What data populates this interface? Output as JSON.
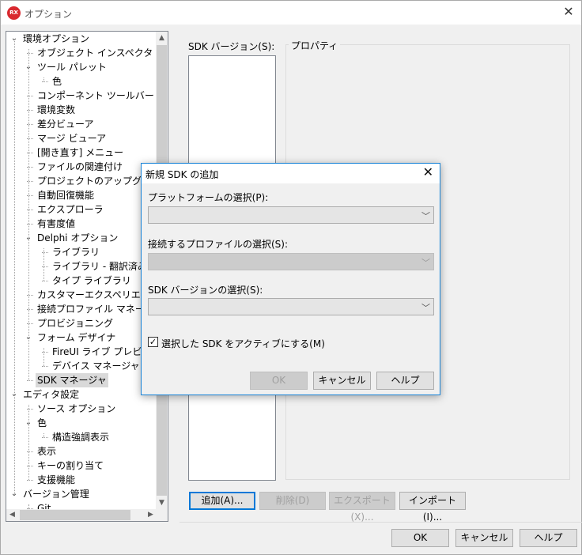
{
  "window": {
    "app_logo": "RX",
    "title": "オプション",
    "close_glyph": "✕"
  },
  "tree": {
    "items": [
      {
        "label": "環境オプション",
        "level": 0,
        "expanded": true
      },
      {
        "label": "オブジェクト インスペクタ",
        "level": 1
      },
      {
        "label": "ツール パレット",
        "level": 1,
        "expanded": true
      },
      {
        "label": "色",
        "level": 2
      },
      {
        "label": "コンポーネント ツールバー",
        "level": 1
      },
      {
        "label": "環境変数",
        "level": 1
      },
      {
        "label": "差分ビューア",
        "level": 1
      },
      {
        "label": "マージ ビューア",
        "level": 1
      },
      {
        "label": "[開き直す] メニュー",
        "level": 1
      },
      {
        "label": "ファイルの関連付け",
        "level": 1
      },
      {
        "label": "プロジェクトのアップグレード",
        "level": 1
      },
      {
        "label": "自動回復機能",
        "level": 1
      },
      {
        "label": "エクスプローラ",
        "level": 1
      },
      {
        "label": "有害度値",
        "level": 1
      },
      {
        "label": "Delphi オプション",
        "level": 1,
        "expanded": true
      },
      {
        "label": "ライブラリ",
        "level": 2
      },
      {
        "label": "ライブラリ - 翻訳済み",
        "level": 2
      },
      {
        "label": "タイプ ライブラリ",
        "level": 2
      },
      {
        "label": "カスタマーエクスペリエンス プ",
        "level": 1
      },
      {
        "label": "接続プロファイル マネージャ",
        "level": 1
      },
      {
        "label": "プロビジョニング",
        "level": 1
      },
      {
        "label": "フォーム デザイナ",
        "level": 1,
        "expanded": true
      },
      {
        "label": "FireUI ライブ プレビュー",
        "level": 2
      },
      {
        "label": "デバイス マネージャ",
        "level": 2
      },
      {
        "label": "SDK マネージャ",
        "level": 1,
        "selected": true
      },
      {
        "label": "エディタ設定",
        "level": 0,
        "expanded": true
      },
      {
        "label": "ソース オプション",
        "level": 1
      },
      {
        "label": "色",
        "level": 1,
        "expanded": true
      },
      {
        "label": "構造強調表示",
        "level": 2
      },
      {
        "label": "表示",
        "level": 1
      },
      {
        "label": "キーの割り当て",
        "level": 1
      },
      {
        "label": "支援機能",
        "level": 1
      },
      {
        "label": "バージョン管理",
        "level": 0,
        "expanded": true
      },
      {
        "label": "Git",
        "level": 1
      }
    ]
  },
  "right_pane": {
    "sdk_version_label": "SDK バージョン(S):",
    "properties_label": "プロパティ",
    "buttons": {
      "add": "追加(A)...",
      "delete": "削除(D)",
      "export": "エクスポート(X)...",
      "import": "インポート(I)..."
    }
  },
  "footer": {
    "ok": "OK",
    "cancel": "キャンセル",
    "help": "ヘルプ"
  },
  "dialog": {
    "title": "新規 SDK の追加",
    "platform_label": "プラットフォームの選択(P):",
    "profile_label": "接続するプロファイルの選択(S):",
    "sdk_version_label": "SDK バージョンの選択(S):",
    "activate_checkbox_label": "選択した SDK をアクティブにする(M)",
    "activate_checked": true,
    "ok": "OK",
    "cancel": "キャンセル",
    "help": "ヘルプ"
  }
}
